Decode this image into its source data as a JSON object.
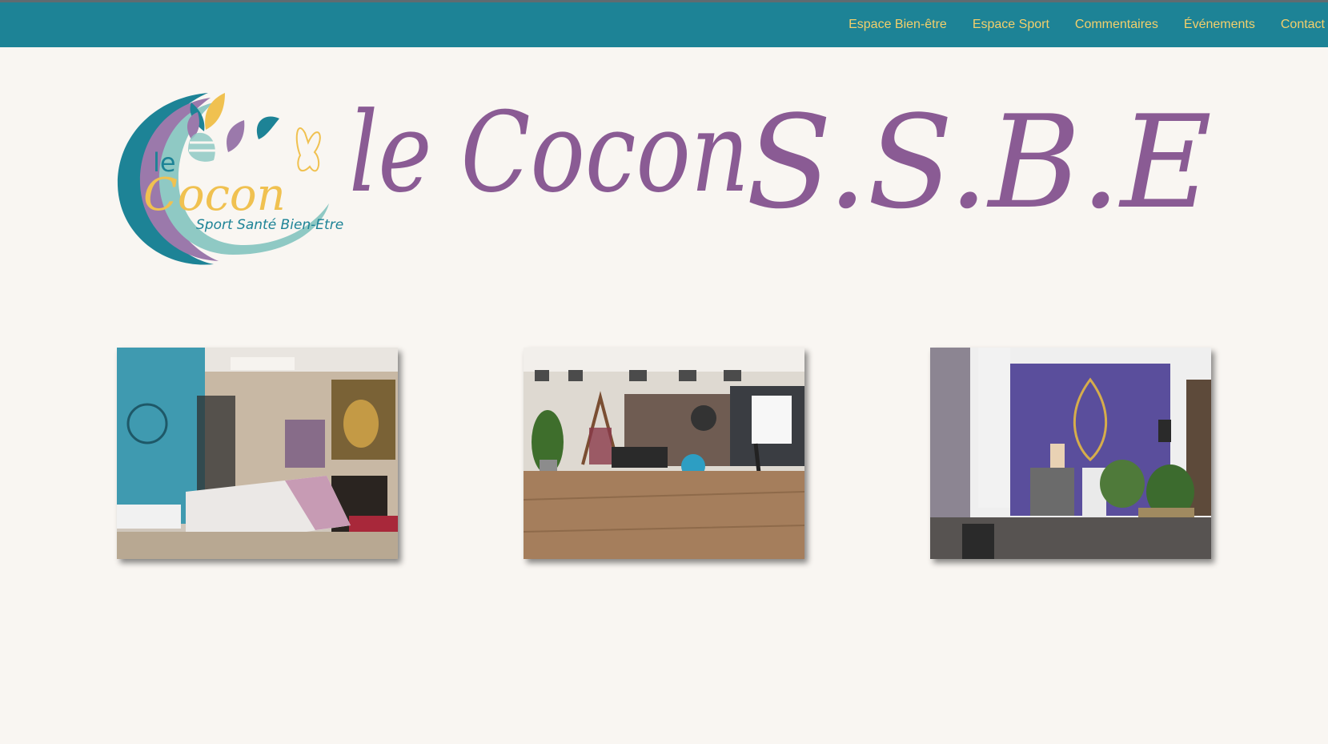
{
  "nav": {
    "items": [
      {
        "label": "Espace Bien-être"
      },
      {
        "label": "Espace Sport"
      },
      {
        "label": "Commentaires"
      },
      {
        "label": "Événements"
      },
      {
        "label": "Contact"
      }
    ]
  },
  "logo": {
    "emblem_word_1": "le",
    "emblem_word_2": "Cocon",
    "emblem_tagline": "Sport Santé Bien-Etre",
    "title_part_1": "le Cocon",
    "title_part_2": "S.S.B.E"
  },
  "colors": {
    "navbar": "#1d8396",
    "nav_text": "#f3cf6b",
    "background": "#f9f6f2",
    "title_purple": "#8a5b94",
    "teal": "#1d8396",
    "light_teal": "#8fc9c4",
    "gold": "#f0c150"
  },
  "gallery": {
    "photos": [
      {
        "icon": "massage-room-photo"
      },
      {
        "icon": "sport-room-photo"
      },
      {
        "icon": "reception-room-photo"
      }
    ]
  }
}
